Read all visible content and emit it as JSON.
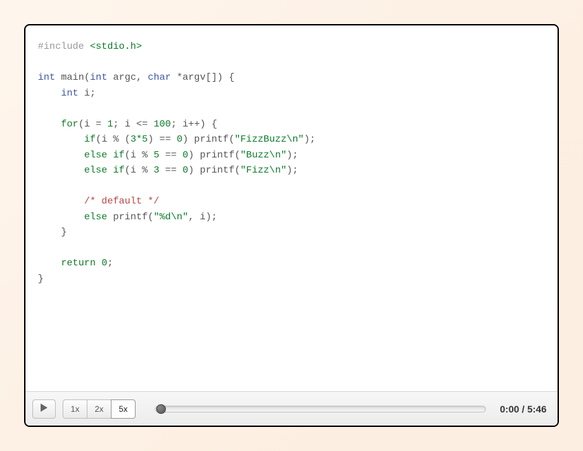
{
  "code": {
    "preproc_directive": "#include",
    "include_header": "<stdio.h>",
    "kw_int": "int",
    "fn_main": "main",
    "kw_char": "char",
    "id_argc": "argc",
    "id_argv": "argv",
    "id_i": "i",
    "kw_for": "for",
    "n1": "1",
    "n100": "100",
    "n3t5": "3*5",
    "n0": "0",
    "n5": "5",
    "n3": "3",
    "kw_if": "if",
    "kw_else": "else",
    "fn_printf": "printf",
    "str_fizzbuzz": "\"FizzBuzz\\n\"",
    "str_buzz": "\"Buzz\\n\"",
    "str_fizz": "\"Fizz\\n\"",
    "str_fmt": "\"%d\\n\"",
    "comment_default": "/* default */",
    "kw_return": "return"
  },
  "controls": {
    "speeds": [
      "1x",
      "2x",
      "5x"
    ],
    "active_speed_index": 2,
    "time_current": "0:00",
    "time_total": "5:46",
    "time_sep": " / "
  }
}
